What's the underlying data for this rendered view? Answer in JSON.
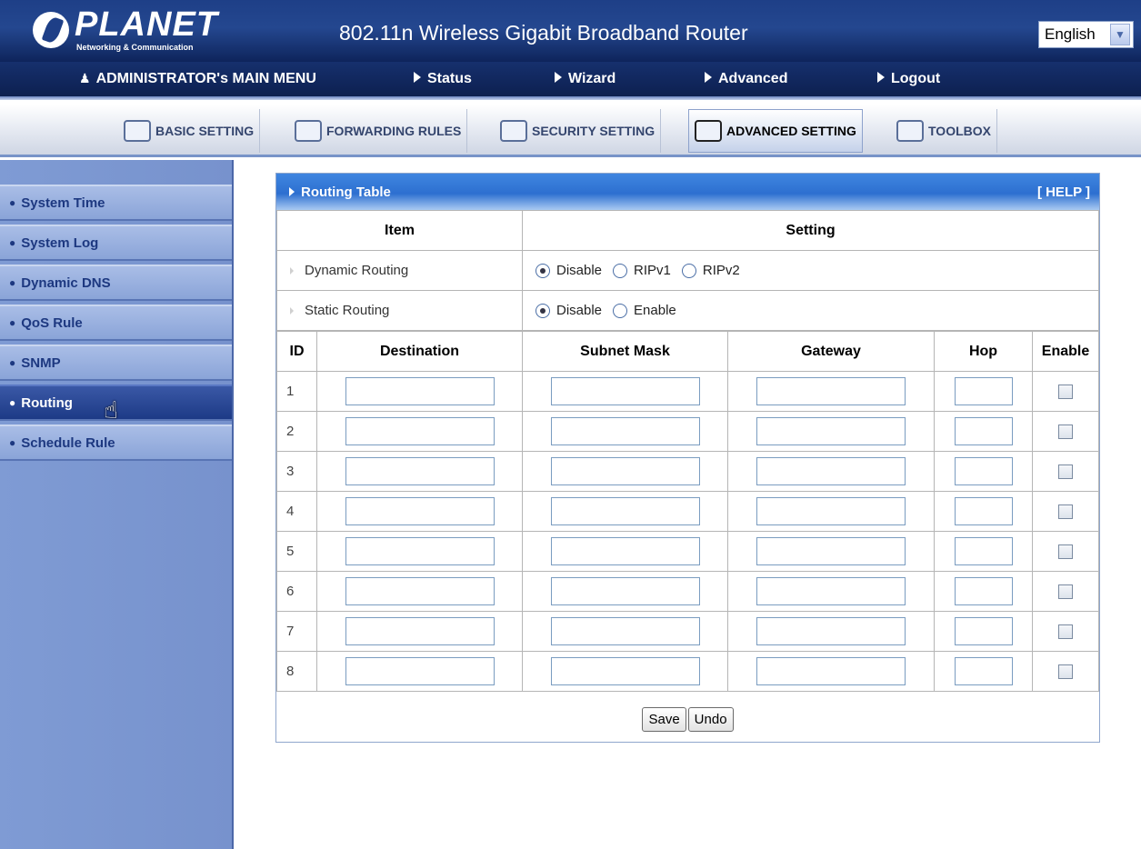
{
  "header": {
    "logo_text": "PLANET",
    "logo_subtext": "Networking & Communication",
    "title": "802.11n Wireless Gigabit Broadband Router",
    "language": "English"
  },
  "menu": {
    "admin": "ADMINISTRATOR's MAIN MENU",
    "status": "Status",
    "wizard": "Wizard",
    "advanced": "Advanced",
    "logout": "Logout"
  },
  "tabs": {
    "basic": "BASIC SETTING",
    "forwarding": "FORWARDING RULES",
    "security": "SECURITY SETTING",
    "advanced": "ADVANCED SETTING",
    "toolbox": "TOOLBOX"
  },
  "sidebar": {
    "items": [
      "System Time",
      "System Log",
      "Dynamic DNS",
      "QoS Rule",
      "SNMP",
      "Routing",
      "Schedule Rule"
    ],
    "active": "Routing"
  },
  "panel": {
    "title": "Routing Table",
    "help": "[ HELP ]",
    "item_header": "Item",
    "setting_header": "Setting",
    "dynamic_routing": {
      "label": "Dynamic Routing",
      "options": [
        "Disable",
        "RIPv1",
        "RIPv2"
      ],
      "selected": "Disable"
    },
    "static_routing": {
      "label": "Static Routing",
      "options": [
        "Disable",
        "Enable"
      ],
      "selected": "Disable"
    },
    "columns": [
      "ID",
      "Destination",
      "Subnet Mask",
      "Gateway",
      "Hop",
      "Enable"
    ],
    "rows": [
      {
        "id": "1",
        "destination": "",
        "subnet_mask": "",
        "gateway": "",
        "hop": "",
        "enabled": false
      },
      {
        "id": "2",
        "destination": "",
        "subnet_mask": "",
        "gateway": "",
        "hop": "",
        "enabled": false
      },
      {
        "id": "3",
        "destination": "",
        "subnet_mask": "",
        "gateway": "",
        "hop": "",
        "enabled": false
      },
      {
        "id": "4",
        "destination": "",
        "subnet_mask": "",
        "gateway": "",
        "hop": "",
        "enabled": false
      },
      {
        "id": "5",
        "destination": "",
        "subnet_mask": "",
        "gateway": "",
        "hop": "",
        "enabled": false
      },
      {
        "id": "6",
        "destination": "",
        "subnet_mask": "",
        "gateway": "",
        "hop": "",
        "enabled": false
      },
      {
        "id": "7",
        "destination": "",
        "subnet_mask": "",
        "gateway": "",
        "hop": "",
        "enabled": false
      },
      {
        "id": "8",
        "destination": "",
        "subnet_mask": "",
        "gateway": "",
        "hop": "",
        "enabled": false
      }
    ],
    "save_label": "Save",
    "undo_label": "Undo"
  },
  "colors": {
    "header_blue": "#1e3f87",
    "sidebar_blue": "#7f9bd4",
    "panel_header": "#2d6fd0"
  }
}
